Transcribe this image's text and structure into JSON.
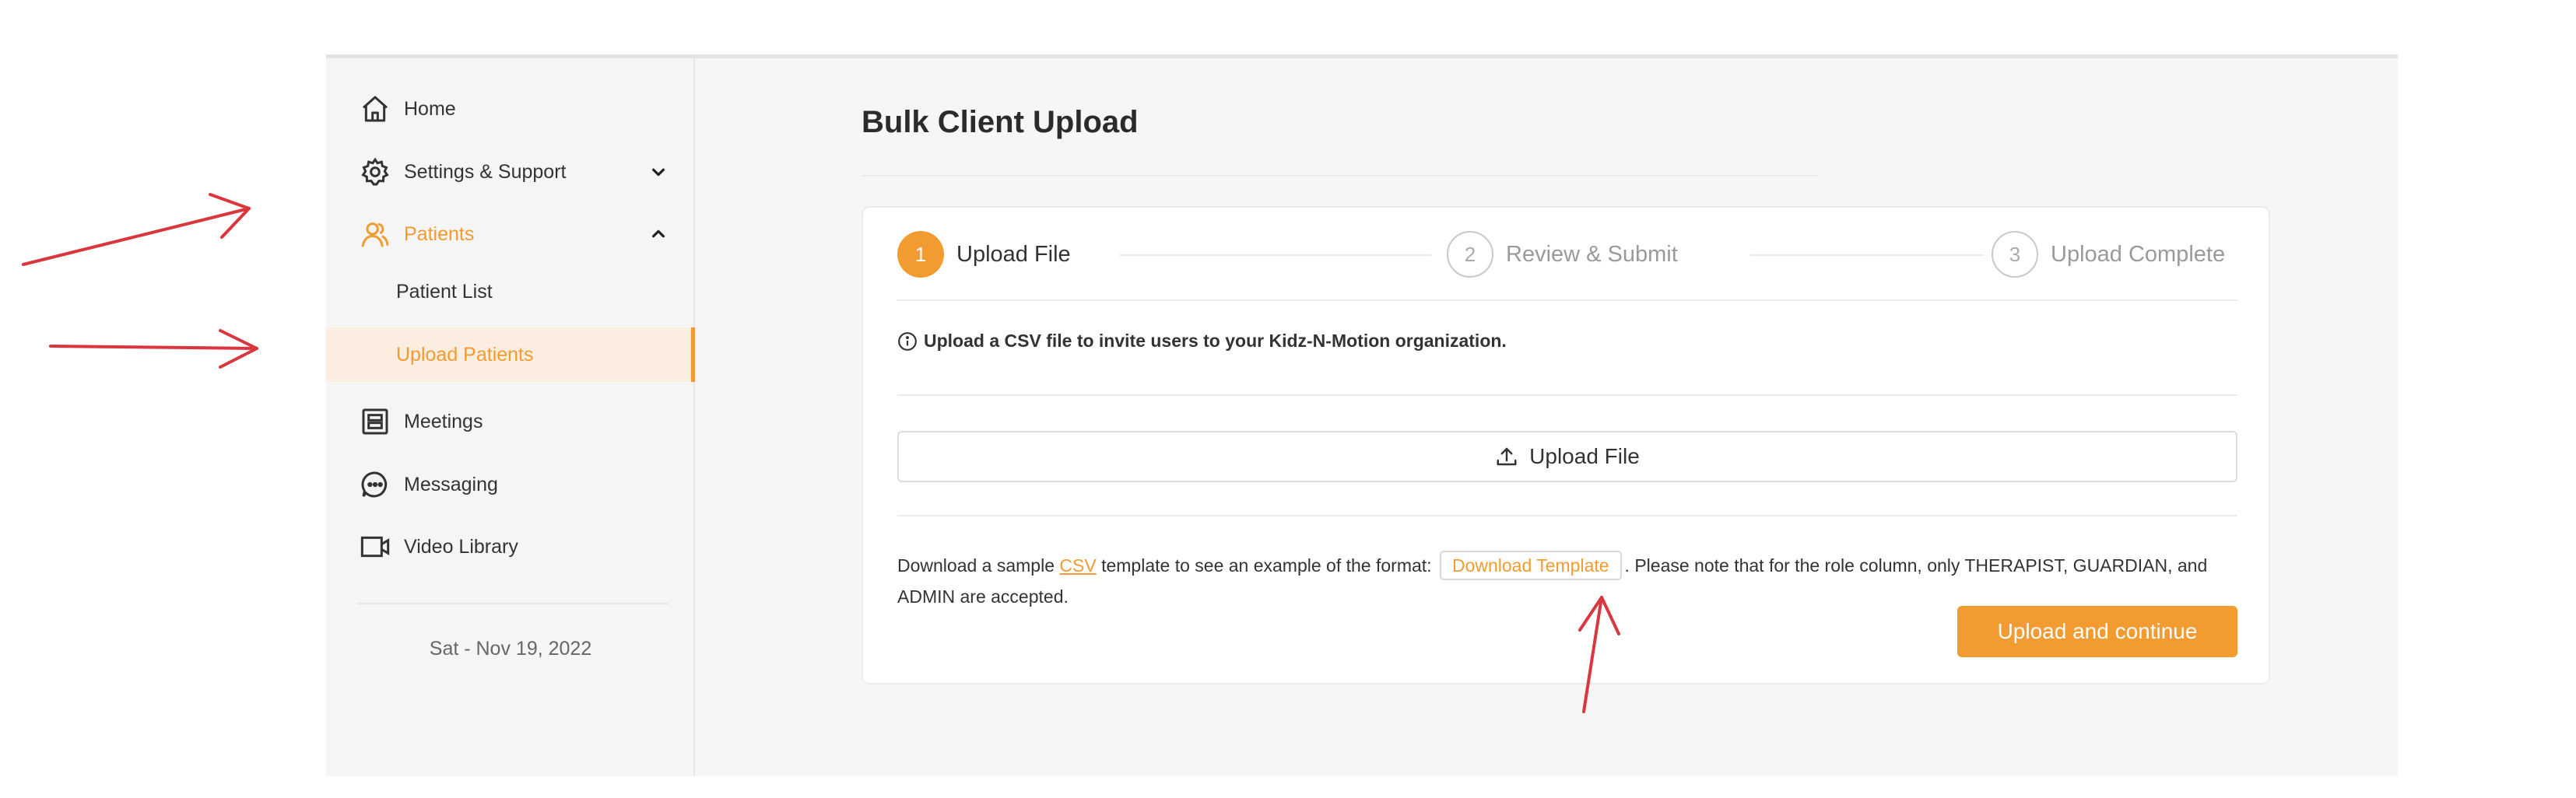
{
  "sidebar": {
    "items": [
      {
        "label": "Home",
        "icon": "home-icon"
      },
      {
        "label": "Settings & Support",
        "icon": "gear-icon"
      },
      {
        "label": "Patients",
        "icon": "patients-icon"
      },
      {
        "label": "Meetings",
        "icon": "meetings-icon"
      },
      {
        "label": "Messaging",
        "icon": "chat-icon"
      },
      {
        "label": "Video Library",
        "icon": "video-icon"
      }
    ],
    "sub_items": [
      {
        "label": "Patient List"
      },
      {
        "label": "Upload Patients"
      }
    ],
    "date": "Sat - Nov 19, 2022"
  },
  "main": {
    "title": "Bulk Client Upload",
    "steps": [
      {
        "num": "1",
        "label": "Upload File"
      },
      {
        "num": "2",
        "label": "Review & Submit"
      },
      {
        "num": "3",
        "label": "Upload Complete"
      }
    ],
    "info_text": "Upload a CSV file to invite users to your Kidz-N-Motion organization.",
    "upload_button": "Upload File",
    "note_prefix": "Download a sample",
    "csv_link": "CSV",
    "note_middle": "template to see an example of the format:",
    "template_button": "Download Template",
    "note_suffix": ". Please note that for the role column, only THERAPIST, GUARDIAN, and ADMIN are accepted.",
    "continue_button": "Upload and continue"
  },
  "colors": {
    "accent": "#f29b31",
    "annotation_arrow": "#d9363e"
  }
}
